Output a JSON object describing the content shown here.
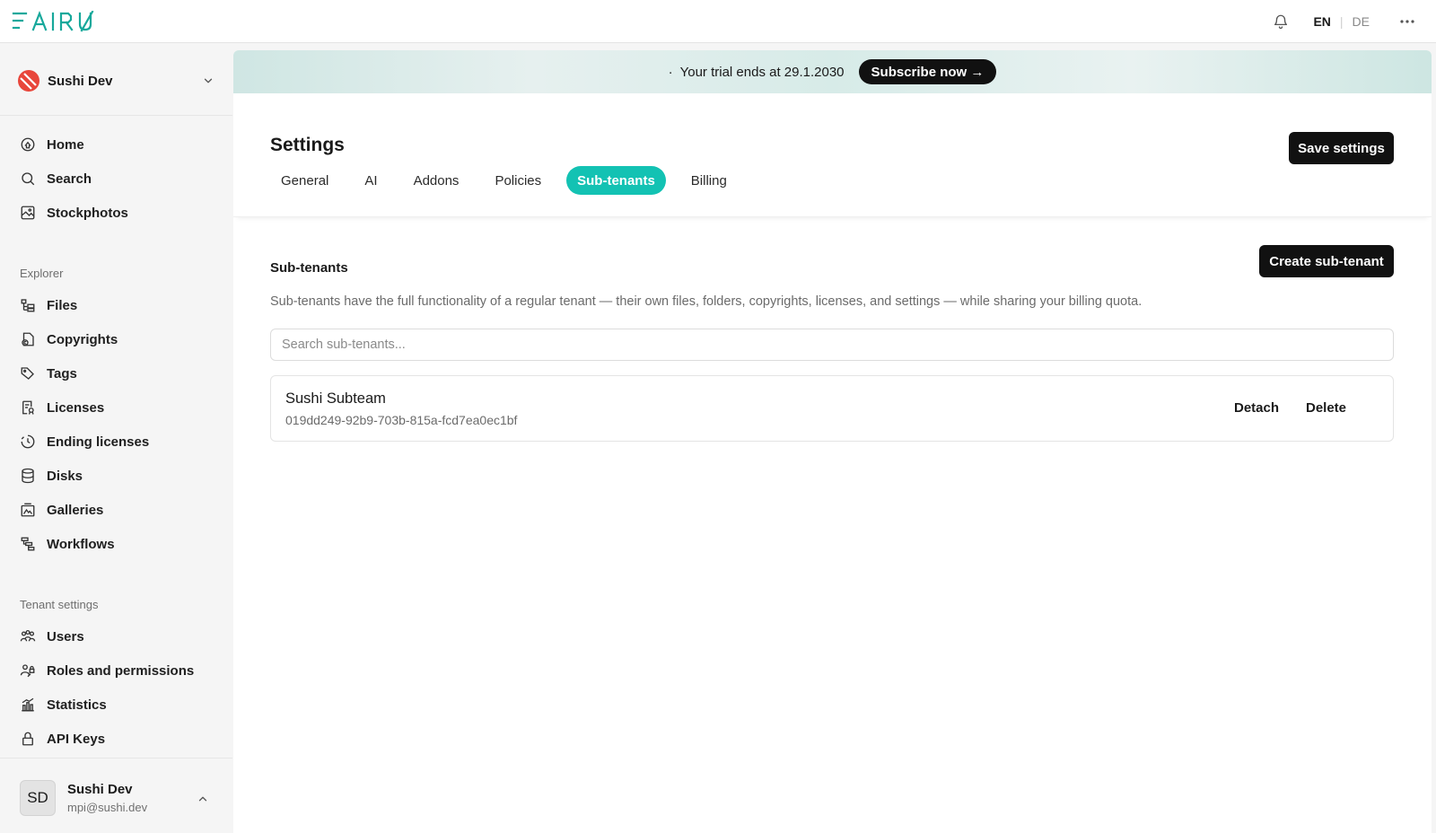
{
  "topbar": {
    "logo_text": "FAIRU",
    "lang_en": "EN",
    "lang_separator": "|",
    "lang_de": "DE"
  },
  "sidebar": {
    "tenant_name": "Sushi Dev",
    "main_items": [
      {
        "label": "Home",
        "icon": "home-icon"
      },
      {
        "label": "Search",
        "icon": "search-icon"
      },
      {
        "label": "Stockphotos",
        "icon": "stockphotos-icon"
      }
    ],
    "explorer_label": "Explorer",
    "explorer_items": [
      {
        "label": "Files",
        "icon": "files-icon"
      },
      {
        "label": "Copyrights",
        "icon": "copyrights-icon"
      },
      {
        "label": "Tags",
        "icon": "tag-icon"
      },
      {
        "label": "Licenses",
        "icon": "licenses-icon"
      },
      {
        "label": "Ending licenses",
        "icon": "ending-licenses-icon"
      },
      {
        "label": "Disks",
        "icon": "disks-icon"
      },
      {
        "label": "Galleries",
        "icon": "galleries-icon"
      },
      {
        "label": "Workflows",
        "icon": "workflows-icon"
      }
    ],
    "tenant_settings_label": "Tenant settings",
    "tenant_items": [
      {
        "label": "Users",
        "icon": "users-icon"
      },
      {
        "label": "Roles and permissions",
        "icon": "roles-icon"
      },
      {
        "label": "Statistics",
        "icon": "statistics-icon"
      },
      {
        "label": "API Keys",
        "icon": "lock-icon"
      }
    ],
    "user": {
      "initials": "SD",
      "name": "Sushi Dev",
      "email": "mpi@sushi.dev"
    }
  },
  "banner": {
    "dot": "·",
    "text": "Your trial ends at 29.1.2030",
    "subscribe_label": "Subscribe now →"
  },
  "settings": {
    "title": "Settings",
    "save_label": "Save settings",
    "tabs": [
      {
        "label": "General",
        "active": false
      },
      {
        "label": "AI",
        "active": false
      },
      {
        "label": "Addons",
        "active": false
      },
      {
        "label": "Policies",
        "active": false
      },
      {
        "label": "Sub-tenants",
        "active": true
      },
      {
        "label": "Billing",
        "active": false
      }
    ]
  },
  "subtenants": {
    "title": "Sub-tenants",
    "create_label": "Create sub-tenant",
    "description": "Sub-tenants have the full functionality of a regular tenant — their own files, folders, copyrights, licenses, and settings — while sharing your billing quota.",
    "search_placeholder": "Search sub-tenants...",
    "items": [
      {
        "name": "Sushi Subteam",
        "id": "019dd249-92b9-703b-815a-fcd7ea0ec1bf",
        "detach_label": "Detach",
        "delete_label": "Delete"
      }
    ]
  },
  "colors": {
    "accent": "#13c2b3",
    "logo": "#17a89b",
    "dark_button": "#111111"
  }
}
